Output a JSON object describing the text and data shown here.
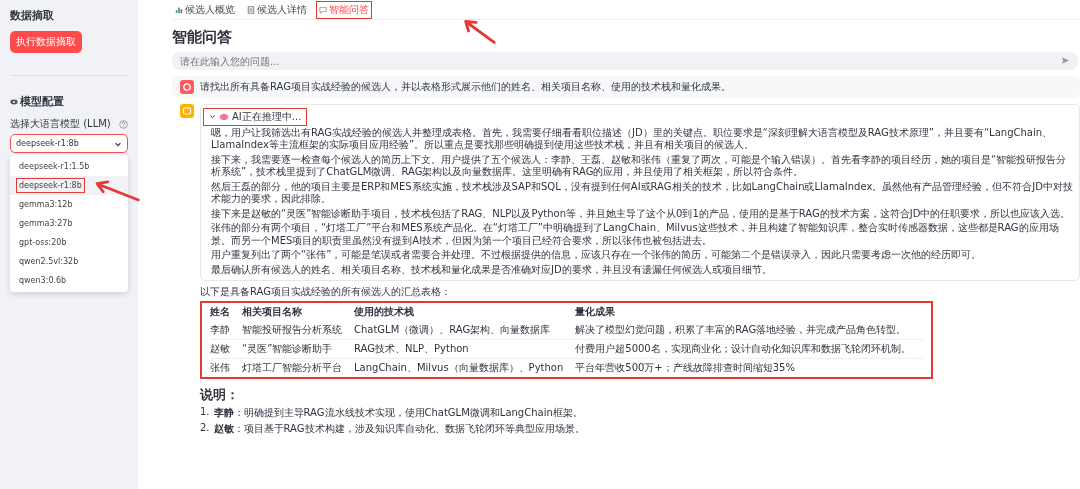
{
  "sidebar": {
    "data_heading": "数据摘取",
    "extract_button": "执行数据摘取",
    "model_heading": "模型配置",
    "model_label": "选择大语言模型 (LLM)",
    "model_select": {
      "value": "deepseek-r1:8b",
      "expanded": true
    },
    "options": [
      {
        "label": "deepseek-r1:1.5b",
        "selected": false,
        "highlighted": false
      },
      {
        "label": "deepseek-r1:8b",
        "selected": true,
        "highlighted": true
      },
      {
        "label": "gemma3:12b",
        "selected": false,
        "highlighted": false
      },
      {
        "label": "gemma3:27b",
        "selected": false,
        "highlighted": false
      },
      {
        "label": "gpt-oss:20b",
        "selected": false,
        "highlighted": false
      },
      {
        "label": "qwen2.5vl:32b",
        "selected": false,
        "highlighted": false
      },
      {
        "label": "qwen3:0.6b",
        "selected": false,
        "highlighted": false
      }
    ]
  },
  "tabs": [
    {
      "label": "候选人概览",
      "kind": "chart",
      "selected": false,
      "highlighted": false
    },
    {
      "label": "候选人详情",
      "kind": "list",
      "selected": false,
      "highlighted": false
    },
    {
      "label": "智能问答",
      "kind": "chat",
      "selected": true,
      "highlighted": true
    }
  ],
  "page_title": "智能问答",
  "question_field": {
    "placeholder": "请在此输入您的问题..."
  },
  "user_message": "请找出所有具备RAG项目实战经验的候选人，并以表格形式展示他们的姓名、相关项目名称、使用的技术栈和量化成果。",
  "reasoning": {
    "label": "AI正在推理中...",
    "expanded": true,
    "highlighted": true,
    "paragraphs": [
      "嗯，用户让我筛选出有RAG实战经验的候选人并整理成表格。首先，我需要仔细看看职位描述（JD）里的关键点。职位要求是“深刻理解大语言模型及RAG技术原理”，并且要有“LangChain、LlamaIndex等主流框架的实际项目应用经验”。所以重点是要找那些明确提到使用这些技术栈，并且有相关项目的候选人。",
      "接下来，我需要逐一检查每个候选人的简历上下文。用户提供了五个候选人：李静、王磊、赵敏和张伟（重复了两次，可能是个输入错误）。首先看李静的项目经历，她的项目是“智能投研报告分析系统”，技术栈里提到了ChatGLM微调、RAG架构以及向量数据库。这里明确有RAG的应用，并且使用了相关框架，所以符合条件。",
      "然后王磊的部分，他的项目主要是ERP和MES系统实施，技术栈涉及SAP和SQL，没有提到任何AI或RAG相关的技术，比如LangChain或LlamaIndex。虽然他有产品管理经验，但不符合JD中对技术能力的要求，因此排除。",
      "接下来是赵敏的“灵医”智能诊断助手项目，技术栈包括了RAG、NLP以及Python等，并且她主导了这个从0到1的产品，使用的是基于RAG的技术方案，这符合JD中的任职要求，所以也应该入选。",
      "张伟的部分有两个项目，“灯塔工厂”平台和MES系统产品化。在“灯塔工厂”中明确提到了LangChain、Milvus这些技术，并且构建了智能知识库，整合实时传感器数据，这些都是RAG的应用场景。而另一个MES项目的职责里虽然没有提到AI技术，但因为第一个项目已经符合要求，所以张伟也被包括进去。",
      "用户重复列出了两个“张伟”，可能是笔误或者需要合并处理。不过根据提供的信息，应该只存在一个张伟的简历，可能第二个是错误录入，因此只需要考虑一次他的经历即可。",
      "最后确认所有候选人的姓名、相关项目名称、技术栈和量化成果是否准确对应JD的要求，并且没有遗漏任何候选人或项目细节。"
    ]
  },
  "summary_intro": "以下是具备RAG项目实战经验的所有候选人的汇总表格：",
  "table": {
    "highlighted": true,
    "columns": [
      "姓名",
      "相关项目名称",
      "使用的技术栈",
      "量化成果"
    ],
    "rows": [
      [
        "李静",
        "智能投研报告分析系统",
        "ChatGLM（微调）、RAG架构、向量数据库",
        "解决了模型幻觉问题，积累了丰富的RAG落地经验，并完成产品角色转型。"
      ],
      [
        "赵敏",
        "“灵医”智能诊断助手",
        "RAG技术、NLP、Python",
        "付费用户超5000名，实现商业化；设计自动化知识库和数据飞轮闭环机制。"
      ],
      [
        "张伟",
        "灯塔工厂智能分析平台",
        "LangChain、Milvus（向量数据库）、Python",
        "平台年营收500万+；产线故障排查时间缩短35%"
      ]
    ]
  },
  "notes": {
    "heading": "说明：",
    "items": [
      {
        "number": "1.",
        "text": "**李静**：明确提到主导RAG流水线技术实现，使用ChatGLM微调和LangChain框架。"
      },
      {
        "number": "2.",
        "text": "**赵敏**：项目基于RAG技术构建，涉及知识库自动化、数据飞轮闭环等典型应用场景。"
      }
    ]
  }
}
